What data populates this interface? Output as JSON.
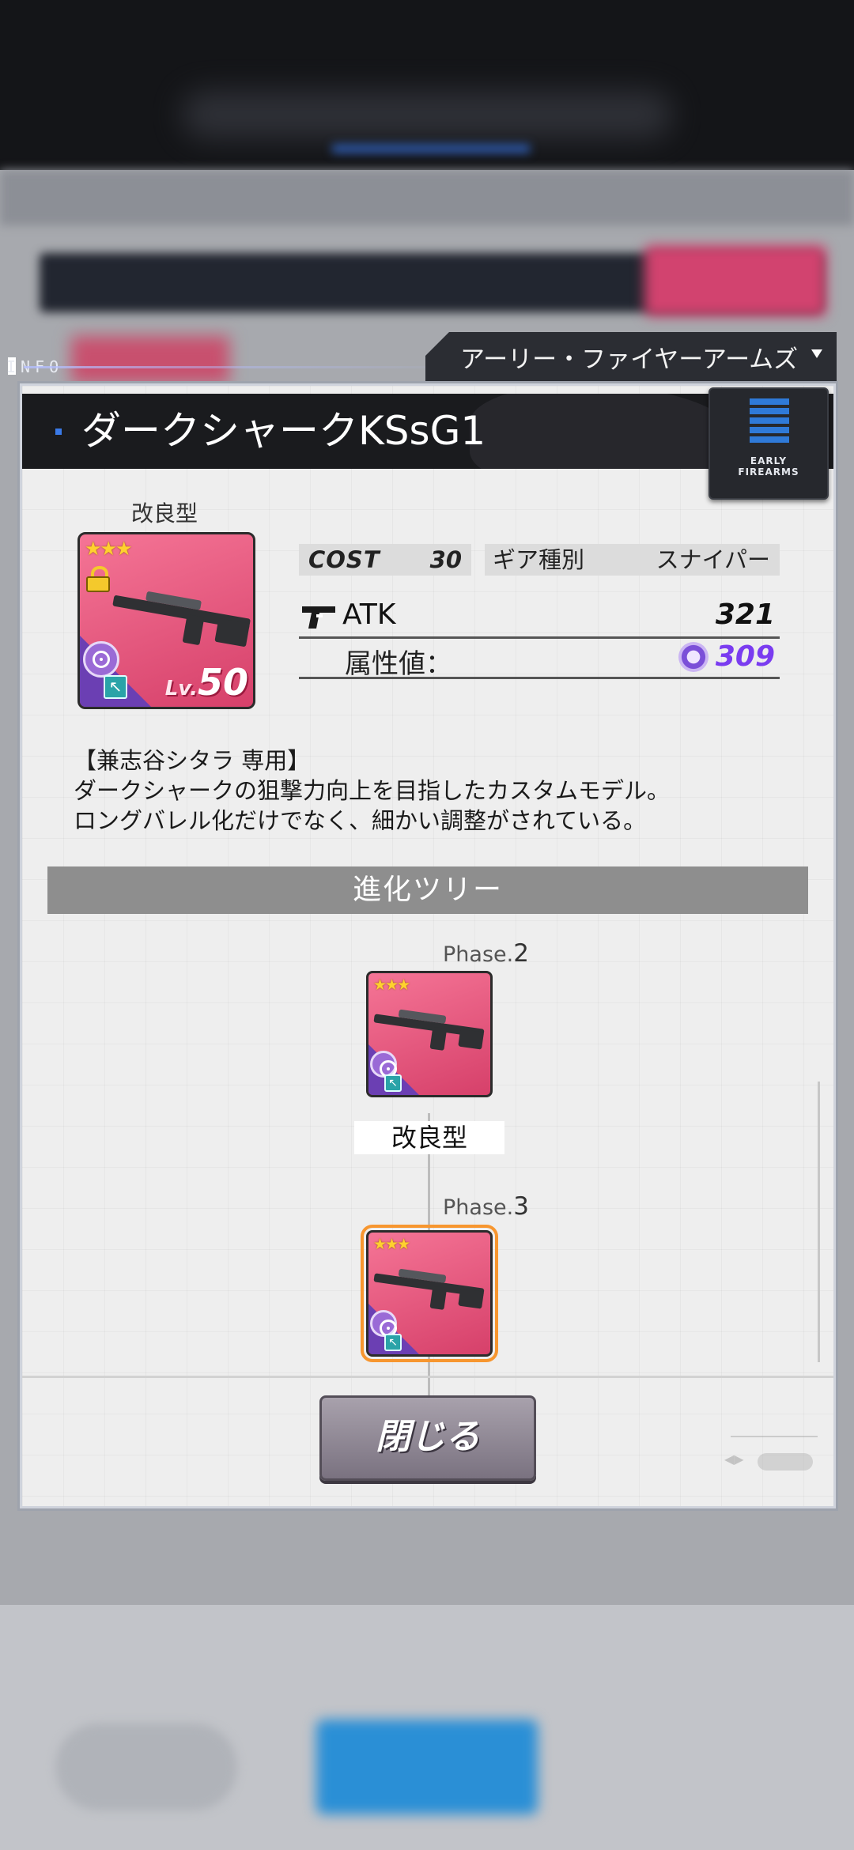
{
  "info_label": "INFO",
  "category": {
    "label": "アーリー・ファイヤーアームズ"
  },
  "weapon": {
    "name": "ダークシャークKSsG1",
    "variant": "改良型",
    "stars": "★★★",
    "level_prefix": "Lv.",
    "level": "50",
    "cost_label": "COST",
    "cost_value": "30",
    "gear_type_label": "ギア種別",
    "gear_type_value": "スナイパー",
    "atk_label": "ATK",
    "atk_value": "321",
    "attribute_label": "属性値：",
    "attribute_value": "309"
  },
  "brand": {
    "line1": "EARLY",
    "line2": "FIREARMS"
  },
  "description": {
    "line1": "【兼志谷シタラ 専用】",
    "line2": "ダークシャークの狙撃力向上を目指したカスタムモデル。",
    "line3": "ロングバレル化だけでなく、細かい調整がされている。"
  },
  "evolution_tree": {
    "header": "進化ツリー",
    "phases": [
      {
        "phase_prefix": "Phase.",
        "phase_num": "2",
        "name": "改良型",
        "stars": "★★★"
      },
      {
        "phase_prefix": "Phase.",
        "phase_num": "3",
        "stars": "★★★"
      }
    ]
  },
  "close_button": {
    "label": "閉じる"
  },
  "colors": {
    "accent_pink": "#e2527a",
    "attribute_purple": "#7a3cf0",
    "selected_orange": "#f7962f"
  }
}
